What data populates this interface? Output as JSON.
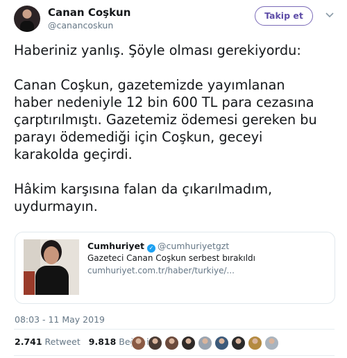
{
  "author": {
    "display_name": "Canan Coşkun",
    "handle": "@canancoskun",
    "follow_label": "Takip et"
  },
  "tweet": {
    "paragraphs": [
      [
        "Haberiniz yanlış. Şöyle olması gerekiyordu:"
      ],
      [
        "Canan Coşkun, gazetemizde yayımlanan",
        "haber nedeniyle 12 bin 600 TL para cezasına",
        "çarptırılmıştı. Gazetemiz ödemesi gereken bu",
        "parayı ödemediği için Coşkun, geceyi",
        "karakolda geçirdi."
      ],
      [
        "Hâkim karşısına falan da çıkarılmadım,",
        "uydurmayın."
      ]
    ],
    "timestamp": "08:03 - 11 May 2019"
  },
  "quoted_card": {
    "source_name": "Cumhuriyet",
    "source_handle": "@cumhuriyetgzt",
    "title": "Gazeteci Canan Coşkun serbest bırakıldı",
    "url": "cumhuriyet.com.tr/haber/turkiye/..."
  },
  "stats": {
    "retweet_count": "2.741",
    "retweet_label": "Retweet",
    "like_count": "9.818",
    "like_label": "Beğeni"
  },
  "likers": [
    {
      "color": "#8a5a44"
    },
    {
      "color": "#4a3b34"
    },
    {
      "color": "#6b4a3c"
    },
    {
      "color": "#2f2a28"
    },
    {
      "color": "#9aa4b0"
    },
    {
      "color": "#3c5a7a"
    },
    {
      "color": "#2b2b2b"
    },
    {
      "color": "#b48a40"
    },
    {
      "color": "#aab4be"
    }
  ],
  "colors": {
    "accent": "#5f4ea8",
    "muted": "#657786",
    "verified": "#1da1f2"
  }
}
